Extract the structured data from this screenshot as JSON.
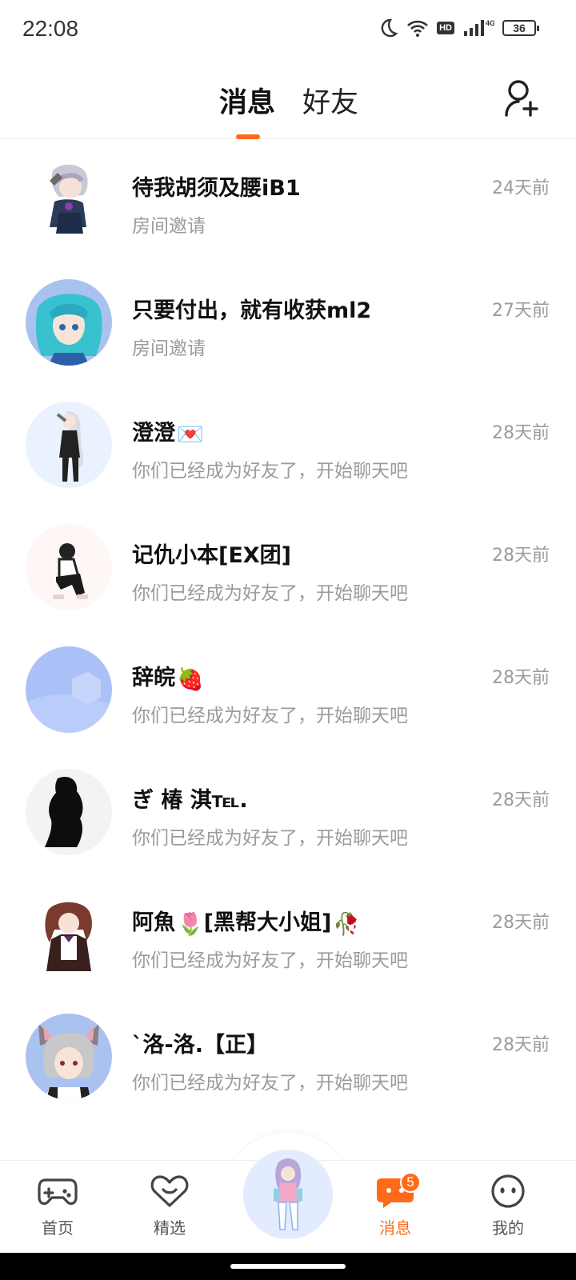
{
  "status_bar": {
    "time": "22:08",
    "battery": "36",
    "hd": "HD",
    "network": "4G"
  },
  "header": {
    "tabs": [
      {
        "label": "消息",
        "active": true
      },
      {
        "label": "好友",
        "active": false
      }
    ],
    "accent": "#ff6a1a"
  },
  "conversations": [
    {
      "name": "待我胡须及腰iB1",
      "subtitle": "房间邀请",
      "time": "24天前"
    },
    {
      "name": "只要付出，就有收获ml2",
      "subtitle": "房间邀请",
      "time": "27天前"
    },
    {
      "name": "澄澄",
      "emoji": "💌",
      "subtitle": "你们已经成为好友了，开始聊天吧",
      "time": "28天前"
    },
    {
      "name": "记仇小本[EX团]",
      "subtitle": "你们已经成为好友了，开始聊天吧",
      "time": "28天前"
    },
    {
      "name": "辞皖",
      "emoji": "🍓",
      "subtitle": "你们已经成为好友了，开始聊天吧",
      "time": "28天前"
    },
    {
      "name": "ぎ 椿 淇℡.",
      "subtitle": "你们已经成为好友了，开始聊天吧",
      "time": "28天前"
    },
    {
      "name": "阿魚",
      "emoji": "🌷",
      "name_suffix": "[黑帮大小姐]",
      "emoji2": "🥀",
      "subtitle": "你们已经成为好友了，开始聊天吧",
      "time": "28天前"
    },
    {
      "name": "`洛-洛.【正】",
      "subtitle": "你们已经成为好友了，开始聊天吧",
      "time": "28天前"
    }
  ],
  "bottom_nav": {
    "items": [
      {
        "label": "首页",
        "icon": "gamepad-icon"
      },
      {
        "label": "精选",
        "icon": "heart-chat-icon"
      },
      {
        "label": "消息",
        "icon": "message-icon",
        "badge": "5",
        "active": true
      },
      {
        "label": "我的",
        "icon": "face-icon"
      }
    ]
  }
}
